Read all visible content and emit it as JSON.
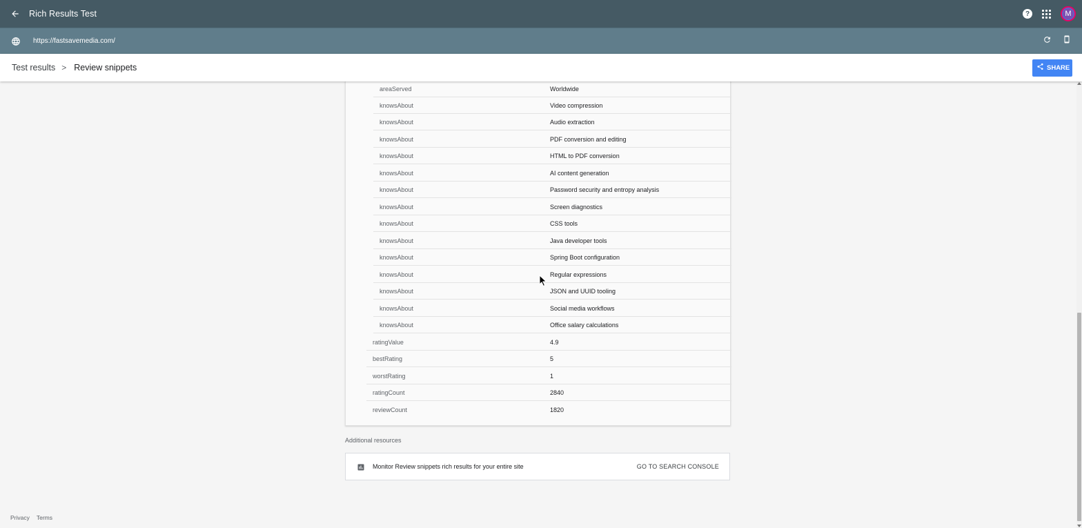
{
  "app": {
    "title": "Rich Results Test"
  },
  "header": {
    "back_icon": "arrow-back-icon",
    "help_icon": "help-icon",
    "apps_icon": "apps-grid-icon",
    "avatar_initial": "M"
  },
  "url_bar": {
    "url": "https://fastsavemedia.com/",
    "globe_icon": "globe-icon",
    "reload_icon": "refresh-icon",
    "device_icon": "smartphone-icon"
  },
  "breadcrumb": {
    "root": "Test results",
    "separator": ">",
    "current": "Review snippets"
  },
  "share": {
    "label": "SHARE",
    "icon": "share-icon",
    "color": "#4285f4"
  },
  "properties": {
    "nested": [
      {
        "key": "areaServed",
        "value": "Worldwide"
      },
      {
        "key": "knowsAbout",
        "value": "Video compression"
      },
      {
        "key": "knowsAbout",
        "value": "Audio extraction"
      },
      {
        "key": "knowsAbout",
        "value": "PDF conversion and editing"
      },
      {
        "key": "knowsAbout",
        "value": "HTML to PDF conversion"
      },
      {
        "key": "knowsAbout",
        "value": "AI content generation"
      },
      {
        "key": "knowsAbout",
        "value": "Password security and entropy analysis"
      },
      {
        "key": "knowsAbout",
        "value": "Screen diagnostics"
      },
      {
        "key": "knowsAbout",
        "value": "CSS tools"
      },
      {
        "key": "knowsAbout",
        "value": "Java developer tools"
      },
      {
        "key": "knowsAbout",
        "value": "Spring Boot configuration"
      },
      {
        "key": "knowsAbout",
        "value": "Regular expressions"
      },
      {
        "key": "knowsAbout",
        "value": "JSON and UUID tooling"
      },
      {
        "key": "knowsAbout",
        "value": "Social media workflows"
      },
      {
        "key": "knowsAbout",
        "value": "Office salary calculations"
      }
    ],
    "top": [
      {
        "key": "ratingValue",
        "value": "4.9"
      },
      {
        "key": "bestRating",
        "value": "5"
      },
      {
        "key": "worstRating",
        "value": "1"
      },
      {
        "key": "ratingCount",
        "value": "2840"
      },
      {
        "key": "reviewCount",
        "value": "1820"
      }
    ]
  },
  "additional_resources": {
    "label": "Additional resources",
    "item_text": "Monitor Review snippets rich results for your entire site",
    "item_icon": "bar-chart-icon",
    "link_label": "GO TO SEARCH CONSOLE"
  },
  "footer": {
    "privacy": "Privacy",
    "terms": "Terms"
  }
}
